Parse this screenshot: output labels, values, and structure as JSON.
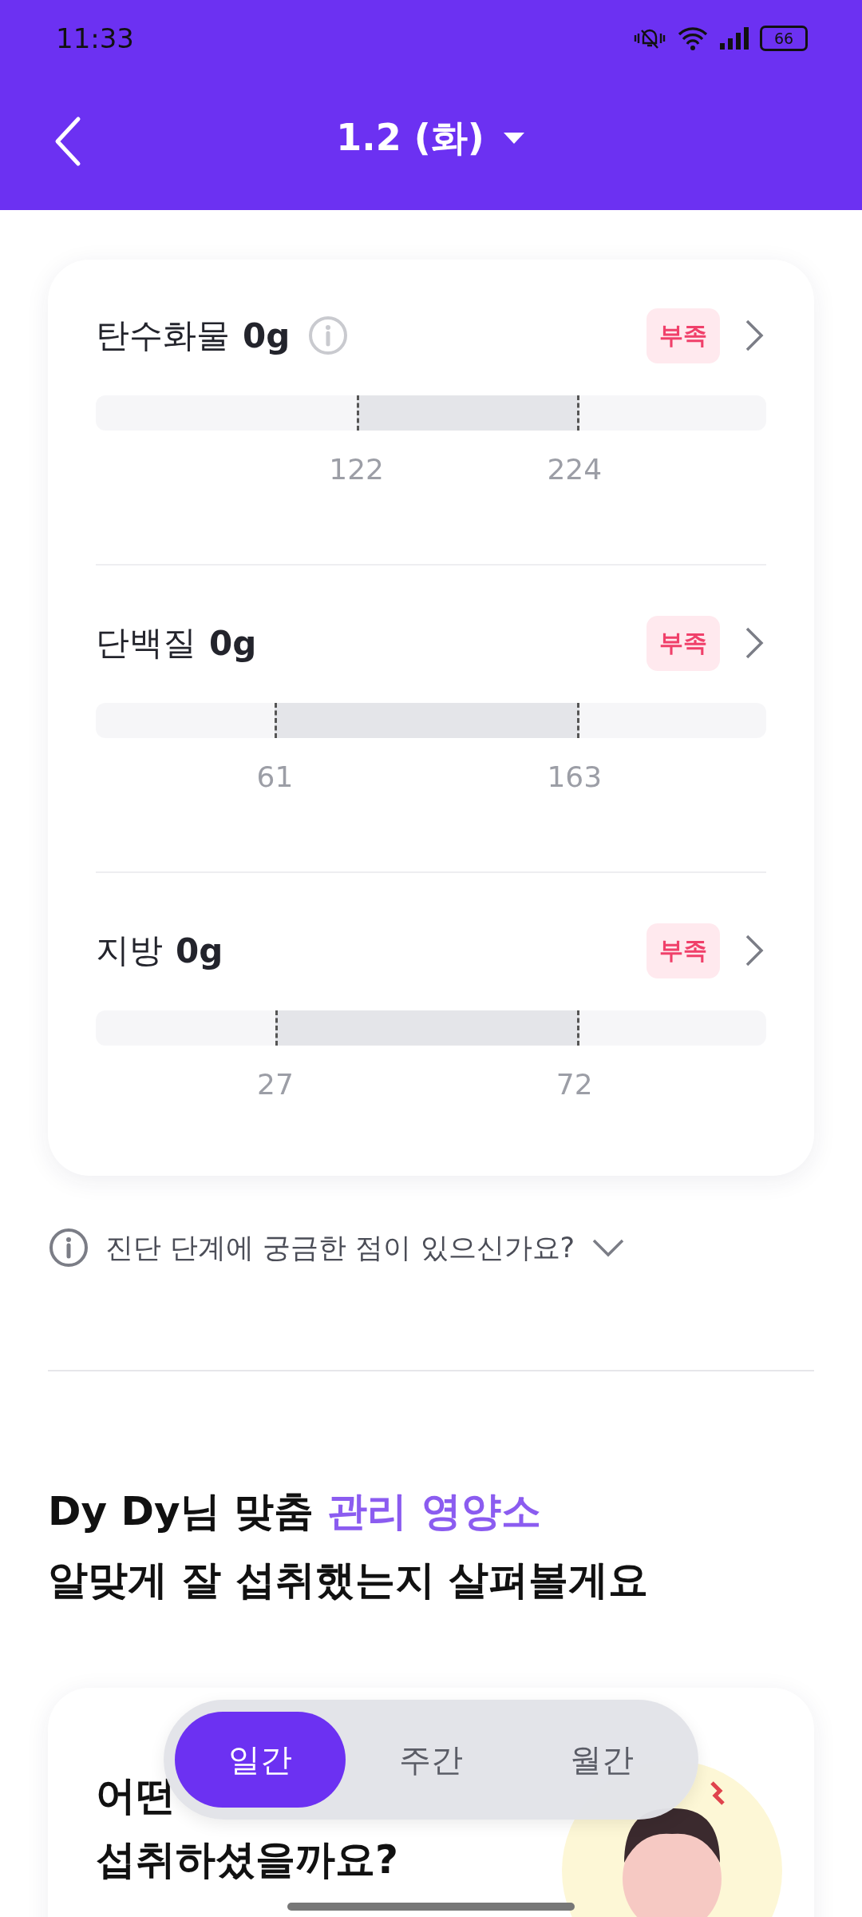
{
  "status_bar": {
    "time": "11:33",
    "battery": "66"
  },
  "header": {
    "title": "1.2 (화)"
  },
  "nutrients": [
    {
      "name": "탄수화물",
      "amount": "0g",
      "has_info": true,
      "status": "부족",
      "low": "122",
      "high": "224"
    },
    {
      "name": "단백질",
      "amount": "0g",
      "has_info": false,
      "status": "부족",
      "low": "61",
      "high": "163"
    },
    {
      "name": "지방",
      "amount": "0g",
      "has_info": false,
      "status": "부족",
      "low": "27",
      "high": "72"
    }
  ],
  "faq": {
    "text": "진단 단계에 궁금한 점이 있으신가요?",
    "expanded": false
  },
  "section": {
    "heading": [
      {
        "text": "Dy Dy님 맞춤 ",
        "highlight": false
      },
      {
        "text": "관리 영양소",
        "highlight": true
      }
    ],
    "subheading": "알맞게 잘 섭취했는지 살펴볼게요"
  },
  "card": {
    "title_lines": [
      "어떤",
      "섭취하셨을까요?"
    ]
  },
  "period_tabs": [
    {
      "label": "일간",
      "selected": true
    },
    {
      "label": "주간",
      "selected": false
    },
    {
      "label": "월간",
      "selected": false
    }
  ]
}
